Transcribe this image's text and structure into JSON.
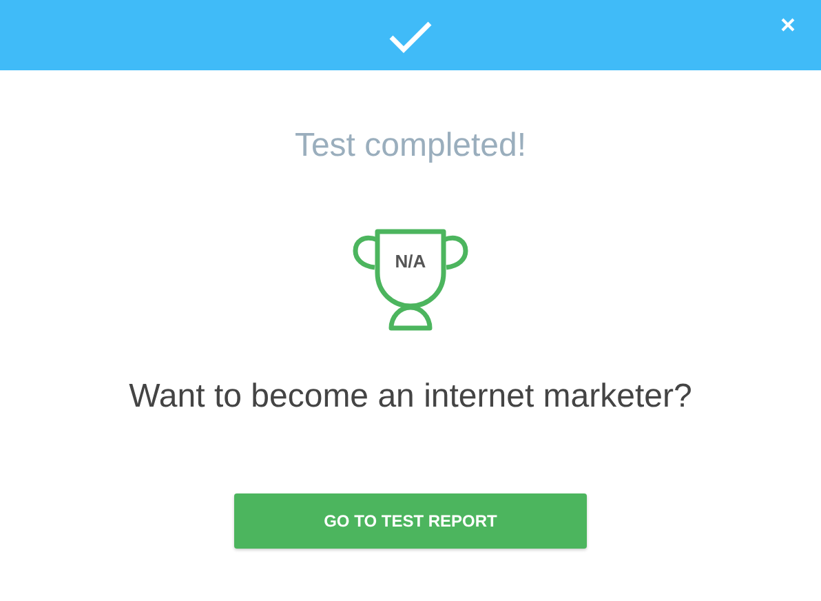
{
  "title": "Test completed!",
  "trophy": {
    "score": "N/A"
  },
  "question": "Want to become an internet marketer?",
  "button": {
    "label": "GO TO TEST REPORT"
  }
}
